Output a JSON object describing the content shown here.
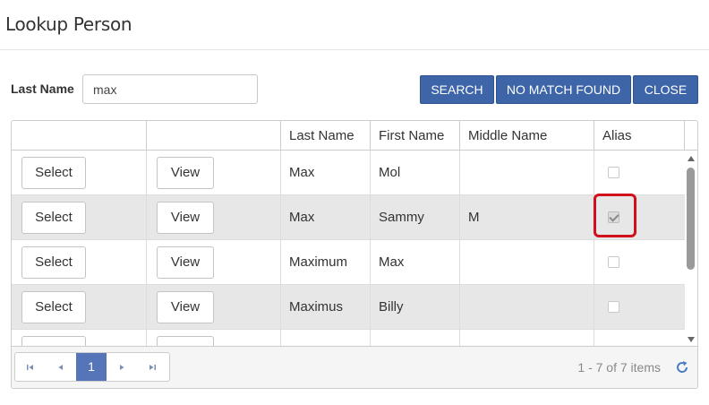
{
  "dialog": {
    "title": "Lookup Person"
  },
  "search": {
    "label": "Last Name",
    "value": "max",
    "buttons": {
      "search": "SEARCH",
      "no_match": "NO MATCH FOUND",
      "close": "CLOSE"
    }
  },
  "grid": {
    "columns": [
      "",
      "",
      "Last Name",
      "First Name",
      "Middle Name",
      "Alias"
    ],
    "rows": [
      {
        "select": "Select",
        "view": "View",
        "last_name": "Max",
        "first_name": "Mol",
        "middle_name": "",
        "alias": false
      },
      {
        "select": "Select",
        "view": "View",
        "last_name": "Max",
        "first_name": "Sammy",
        "middle_name": "M",
        "alias": true
      },
      {
        "select": "Select",
        "view": "View",
        "last_name": "Maximum",
        "first_name": "Max",
        "middle_name": "",
        "alias": false
      },
      {
        "select": "Select",
        "view": "View",
        "last_name": "Maximus",
        "first_name": "Billy",
        "middle_name": "",
        "alias": false
      },
      {
        "select": "Select",
        "view": "View",
        "last_name": "",
        "first_name": "",
        "middle_name": "",
        "alias": false
      }
    ]
  },
  "pager": {
    "current_page": "1",
    "info": "1 - 7 of 7 items",
    "icons": [
      "first-page-icon",
      "prev-page-icon",
      "next-page-icon",
      "last-page-icon",
      "refresh-icon"
    ]
  },
  "colors": {
    "primary": "#3d65a8",
    "highlight": "#d0101a",
    "alt_row": "#e7e7e7"
  }
}
